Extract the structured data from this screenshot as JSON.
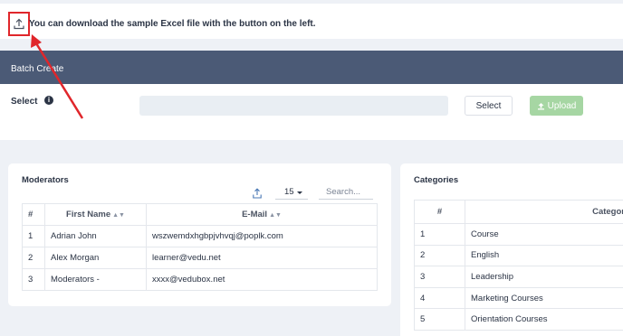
{
  "notice": {
    "text": "You can download the sample Excel file with the button on the left."
  },
  "batch": {
    "title": "Batch Create",
    "select_label": "Select",
    "select_button": "Select",
    "upload_button": "Upload"
  },
  "moderators": {
    "title": "Moderators",
    "page_size": "15",
    "search_placeholder": "Search...",
    "columns": [
      "#",
      "First Name",
      "E-Mail"
    ],
    "rows": [
      [
        "1",
        "Adrian John",
        "wszwemdxhgbpjvhvqj@poplk.com"
      ],
      [
        "2",
        "Alex Morgan",
        "learner@vedu.net"
      ],
      [
        "3",
        "Moderators -",
        "xxxx@vedubox.net"
      ]
    ]
  },
  "categories": {
    "title": "Categories",
    "columns": [
      "#",
      "Categor"
    ],
    "rows": [
      [
        "1",
        "Course"
      ],
      [
        "2",
        "English"
      ],
      [
        "3",
        "Leadership"
      ],
      [
        "4",
        "Marketing Courses"
      ],
      [
        "5",
        "Orientation Courses"
      ]
    ]
  },
  "colors": {
    "header": "#4b5a76",
    "highlight": "#e0262b",
    "upload": "#a6d6a3"
  }
}
